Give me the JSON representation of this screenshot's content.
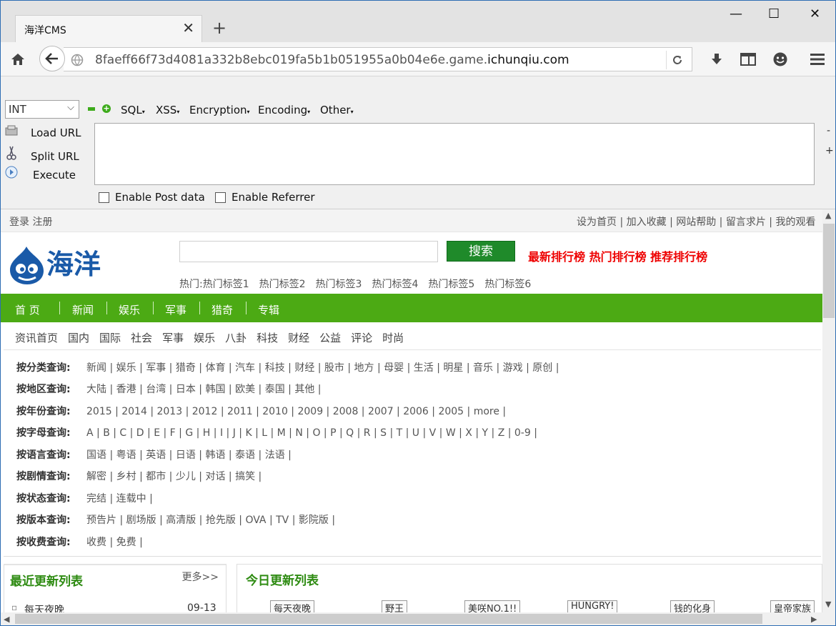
{
  "tab": {
    "title": "海洋CMS",
    "close": "✕",
    "new": "+"
  },
  "window": {
    "minimize": "—",
    "maximize": "☐",
    "close": "✕"
  },
  "nav": {
    "url_prefix": "8faeff66f73d4081a332b8ebc019fa5b1b051955a0b04e6e.game.",
    "url_domain": "ichunqiu.com"
  },
  "hackbar": {
    "select_value": "INT",
    "menus": [
      "SQL",
      "XSS",
      "Encryption",
      "Encoding",
      "Other"
    ],
    "side": {
      "load": "Load URL",
      "split": "Split URL",
      "execute": "Execute"
    },
    "checks": {
      "post": "Enable Post data",
      "referrer": "Enable Referrer"
    },
    "minus": "-",
    "plus": "+"
  },
  "site": {
    "login": "登录 注册",
    "toplinks": "设为首页 | 加入收藏 | 网站帮助 | 留言求片 | 我的观看",
    "logo_text": "海洋",
    "search_button": "搜索",
    "rankings": "最新排行榜 热门排行榜 推荐排行榜",
    "hot_label": "热门:",
    "hot_tags": [
      "热门标签1",
      "热门标签2",
      "热门标签3",
      "热门标签4",
      "热门标签5",
      "热门标签6"
    ],
    "main_nav": [
      "首 页",
      "新闻",
      "娱乐",
      "军事",
      "猎奇",
      "专辑"
    ],
    "sub_nav": [
      "资讯首页",
      "国内",
      "国际",
      "社会",
      "军事",
      "娱乐",
      "八卦",
      "科技",
      "财经",
      "公益",
      "评论",
      "时尚"
    ],
    "filters": [
      {
        "label": "按分类查询:",
        "values": "新闻 |  娱乐 |  军事 |  猎奇 |  体育 |  汽车 |  科技 |  财经 |  股市 |  地方 |  母婴 |  生活 |  明星 |  音乐 |  游戏 |  原创 |"
      },
      {
        "label": "按地区查询:",
        "values": "大陆  |  香港  |  台湾  |  日本  |  韩国  |  欧美  |  泰国  |  其他  |"
      },
      {
        "label": "按年份查询:",
        "values": "2015  |  2014  |  2013  |  2012  |  2011  |  2010  |  2009  |  2008  |  2007  |  2006  |  2005  |  more |"
      },
      {
        "label": "按字母查询:",
        "values": "A |  B |  C |  D |  E |  F |  G |  H |  I |  J |  K |  L |  M |  N |  O |  P |  Q |  R |  S |  T |  U |  V |  W |  X |  Y |  Z |  0-9 |"
      },
      {
        "label": "按语言查询:",
        "values": "国语  |  粤语  |  英语  |  日语  |  韩语  |  泰语  |  法语  |"
      },
      {
        "label": "按剧情查询:",
        "values": "解密 |  乡村 |  都市 |  少儿 |  对话 |  搞笑 |"
      },
      {
        "label": "按状态查询:",
        "values": "完结 |  连载中 |"
      },
      {
        "label": "按版本查询:",
        "values": "预告片  |  剧场版  |  高清版  |  抢先版  |  OVA  |  TV  |  影院版  |"
      },
      {
        "label": "按收费查询:",
        "values": "收费 |  免费 |"
      }
    ],
    "recent": {
      "title": "最近更新列表",
      "more": "更多>>",
      "item": "每天夜晚",
      "date": "09-13"
    },
    "today": {
      "title": "今日更新列表",
      "thumbs": [
        "每天夜晚",
        "野王",
        "美咲NO.1!!",
        "HUNGRY!",
        "钱的化身",
        "皇帝家族"
      ]
    }
  }
}
